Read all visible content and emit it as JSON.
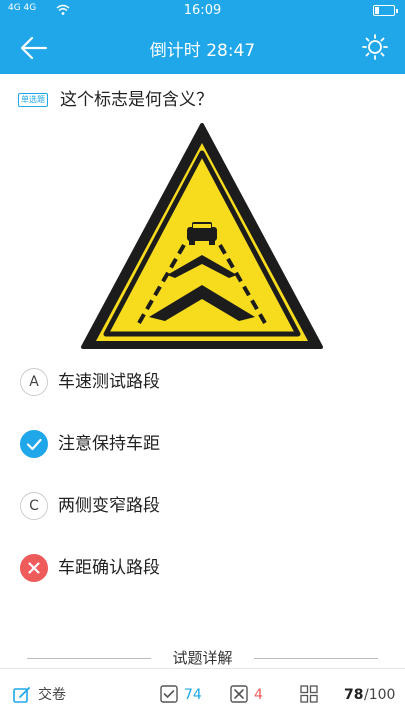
{
  "status_bar": {
    "signal_text": "4G 4G",
    "time": "16:09"
  },
  "header": {
    "title": "倒计时 28:47",
    "back_icon": "back-arrow-icon",
    "theme_icon": "sun-icon"
  },
  "question": {
    "type_tag": "单选题",
    "text": "这个标志是何含义？",
    "image": "narrow-road-traffic-sign"
  },
  "options": [
    {
      "letter": "A",
      "label": "车速测试路段",
      "state": "none"
    },
    {
      "letter": "",
      "label": "注意保持车距",
      "state": "correct"
    },
    {
      "letter": "C",
      "label": "两侧变窄路段",
      "state": "none"
    },
    {
      "letter": "",
      "label": "车距确认路段",
      "state": "wrong"
    }
  ],
  "detail": {
    "label": "试题详解"
  },
  "bottom_bar": {
    "submit_label": "交卷",
    "correct_count": "74",
    "wrong_count": "4",
    "progress_current": "78",
    "progress_total": "/100"
  },
  "colors": {
    "accent": "#1fa7ea",
    "wrong": "#ef5b5b",
    "sign_yellow": "#f7dc1e"
  }
}
